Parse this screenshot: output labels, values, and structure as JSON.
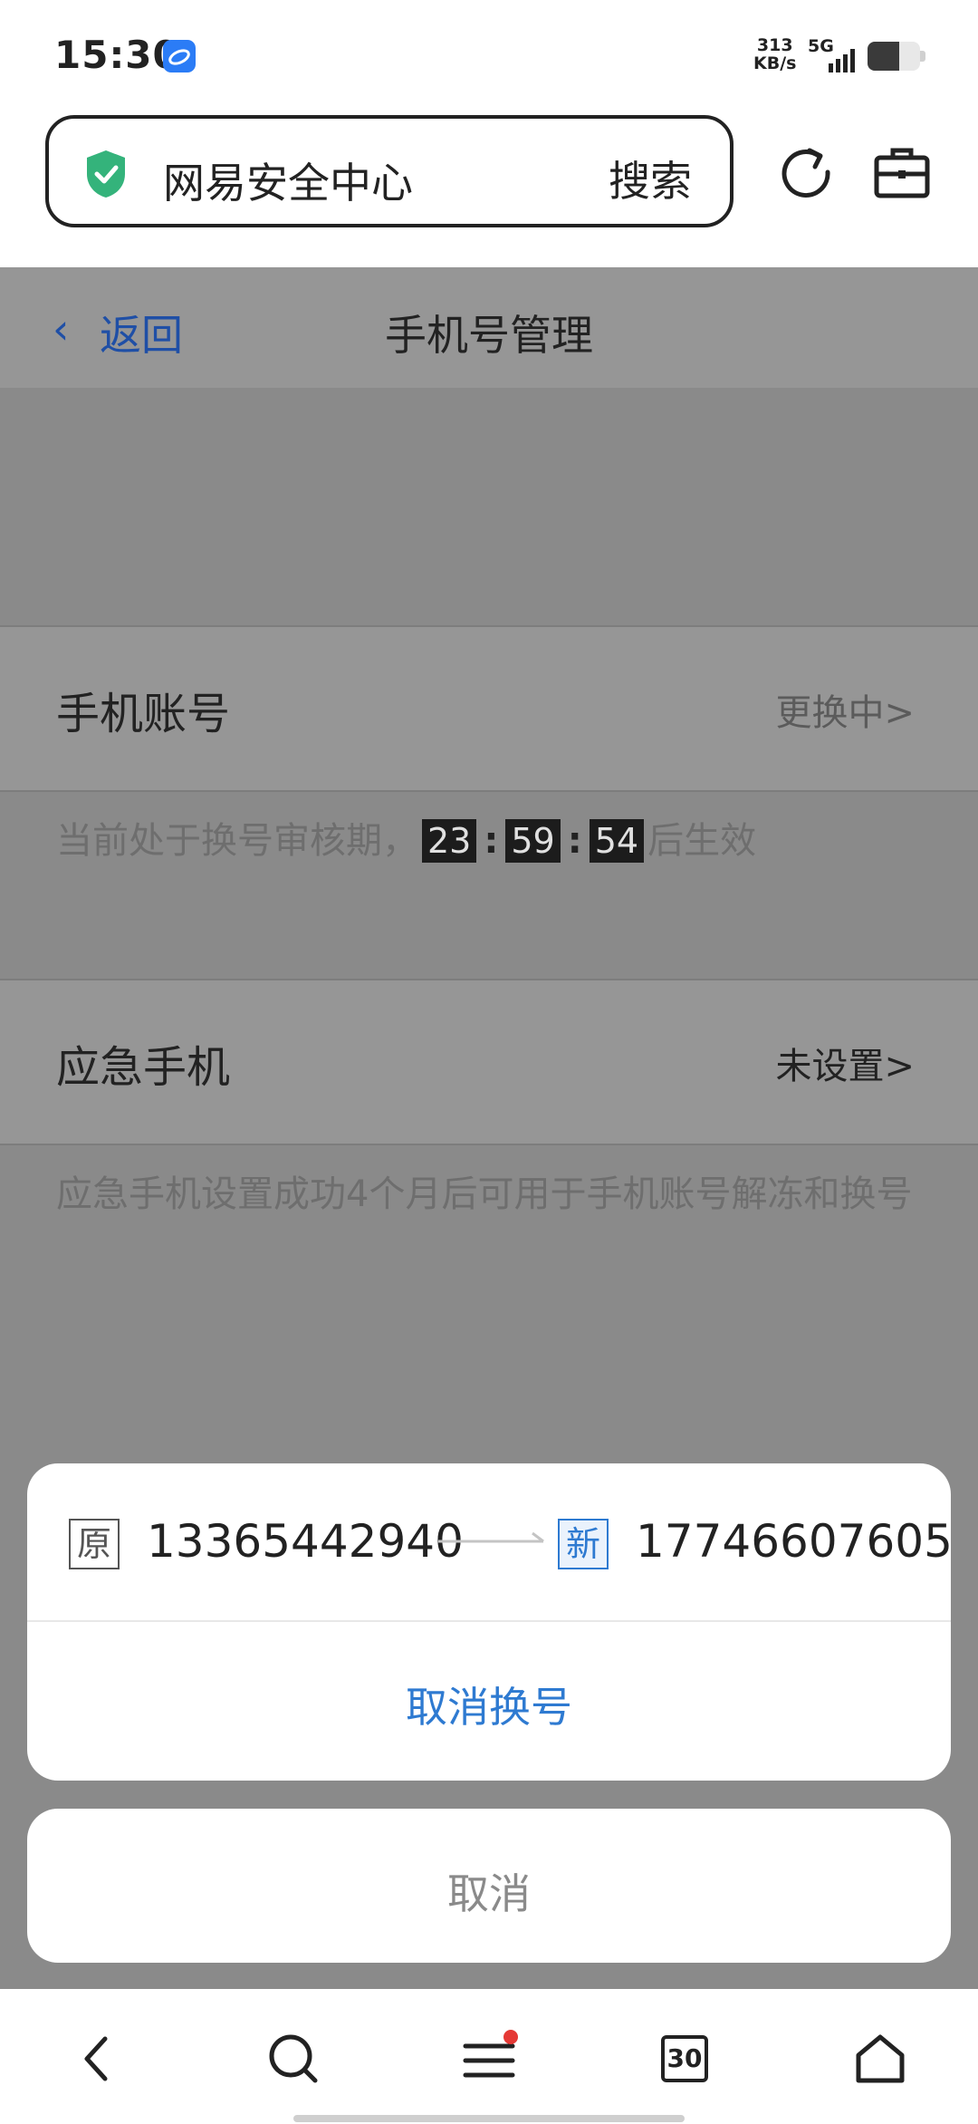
{
  "status_bar": {
    "time": "15:30",
    "net_speed_value": "313",
    "net_speed_unit": "KB/s",
    "signal_label": "5G"
  },
  "browser": {
    "url_title": "网易安全中心",
    "search_label": "搜索"
  },
  "nav": {
    "back_label": "返回",
    "title": "手机号管理"
  },
  "phone_account": {
    "label": "手机账号",
    "value": "更换中>",
    "note_prefix": "当前处于换号审核期，",
    "countdown": [
      "23",
      "59",
      "54"
    ],
    "note_suffix": "后生效"
  },
  "emergency_phone": {
    "label": "应急手机",
    "value": "未设置>",
    "note": "应急手机设置成功4个月后可用于手机账号解冻和换号"
  },
  "sheet": {
    "orig_tag": "原",
    "orig_number": "13365442940",
    "new_tag": "新",
    "new_number": "17746607605",
    "cancel_change_label": "取消换号",
    "cancel_label": "取消"
  },
  "bottom_nav": {
    "tabs_count": "30"
  },
  "colors": {
    "accent": "#2e7ad1",
    "link": "#1f4fa6",
    "shield": "#34b37b",
    "notification_dot": "#e53935"
  }
}
